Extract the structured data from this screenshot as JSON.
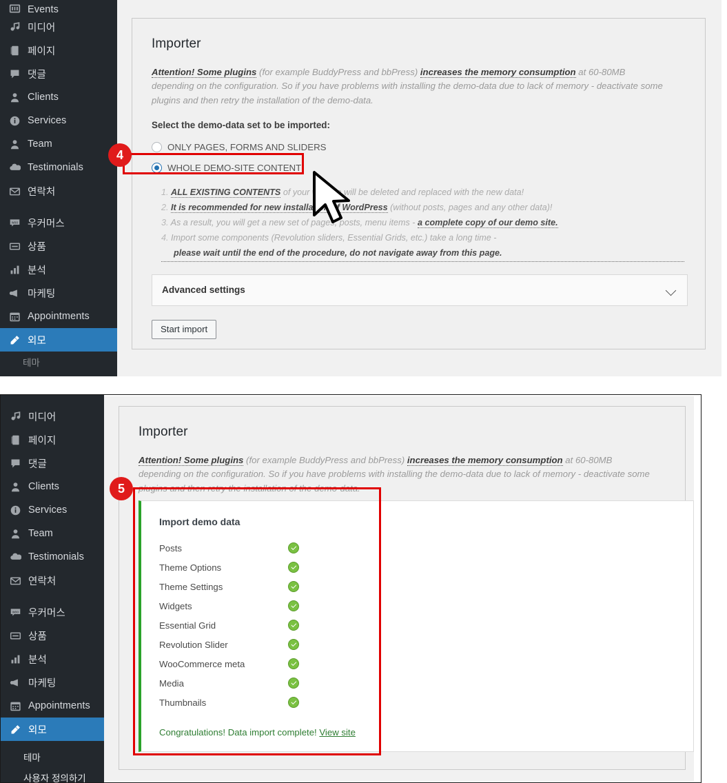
{
  "sidebar": {
    "items": [
      {
        "label": "Events",
        "icon": "events-icon",
        "active": false,
        "clipped": true
      },
      {
        "label": "미디어",
        "icon": "media-icon",
        "active": false
      },
      {
        "label": "페이지",
        "icon": "pages-icon",
        "active": false
      },
      {
        "label": "댓글",
        "icon": "comments-icon",
        "active": false
      },
      {
        "label": "Clients",
        "icon": "clients-icon",
        "active": false
      },
      {
        "label": "Services",
        "icon": "services-icon",
        "active": false
      },
      {
        "label": "Team",
        "icon": "team-icon",
        "active": false
      },
      {
        "label": "Testimonials",
        "icon": "testimonials-icon",
        "active": false
      },
      {
        "label": "연락처",
        "icon": "contacts-icon",
        "active": false
      },
      {
        "label": "우커머스",
        "icon": "woocommerce-icon",
        "active": false,
        "spaced": true
      },
      {
        "label": "상품",
        "icon": "products-icon",
        "active": false
      },
      {
        "label": "분석",
        "icon": "analytics-icon",
        "active": false
      },
      {
        "label": "마케팅",
        "icon": "marketing-icon",
        "active": false
      },
      {
        "label": "Appointments",
        "icon": "appointments-icon",
        "active": false
      },
      {
        "label": "외모",
        "icon": "appearance-icon",
        "active": true
      }
    ],
    "submenu": [
      {
        "label": "테마"
      },
      {
        "label": "사용자 정의하기"
      }
    ],
    "colors": {
      "background": "#23282d",
      "active": "#2b7bb9",
      "text": "#d7dade"
    }
  },
  "importer": {
    "title": "Importer",
    "attention": {
      "lead": "Attention! Some plugins",
      "mid1": " (for example BuddyPress and bbPress) ",
      "highlight": "increases the memory consumption",
      "tail": " at 60-80MB depending on the configuration. So if you have problems with installing the demo-data due to lack of memory - deactivate some plugins and then retry the installation of the demo-data."
    },
    "select_label": "Select the demo-data set to be imported:",
    "radios": [
      {
        "label": "ONLY PAGES, FORMS AND SLIDERS",
        "selected": false
      },
      {
        "label": "WHOLE DEMO-SITE CONTENT",
        "selected": true
      }
    ],
    "notes": [
      {
        "num": "1.",
        "em": "ALL EXISTING CONTENTS",
        "rest": " of your website will be deleted and replaced with the new data!"
      },
      {
        "num": "2.",
        "em": "It is recommended for new installation of WordPress",
        "rest": " (without posts, pages and any other data)!"
      },
      {
        "num": "3.",
        "pre": "As a result, you will get a new set of pages, posts, menu items - ",
        "em": "a complete copy of our demo site."
      },
      {
        "num": "4.",
        "pre": "Import some components (Revolution sliders, Essential Grids, etc.) take a long time -",
        "em2": "please wait until the end of the procedure, do not navigate away from this page."
      }
    ],
    "advanced_settings": "Advanced settings",
    "start_import": "Start import"
  },
  "progress": {
    "title": "Import demo data",
    "rows": [
      {
        "label": "Posts",
        "status": "done"
      },
      {
        "label": "Theme Options",
        "status": "done"
      },
      {
        "label": "Theme Settings",
        "status": "done"
      },
      {
        "label": "Widgets",
        "status": "done"
      },
      {
        "label": "Essential Grid",
        "status": "done"
      },
      {
        "label": "Revolution Slider",
        "status": "done"
      },
      {
        "label": "WooCommerce meta",
        "status": "done"
      },
      {
        "label": "Media",
        "status": "done"
      },
      {
        "label": "Thumbnails",
        "status": "done"
      }
    ],
    "complete_text": "Congratulations! Data import complete!",
    "view_site_link": "View site",
    "accent_color": "#2aa32a"
  },
  "annotations": {
    "badge_4": "4",
    "badge_5": "5",
    "color": "#e01b1b"
  }
}
